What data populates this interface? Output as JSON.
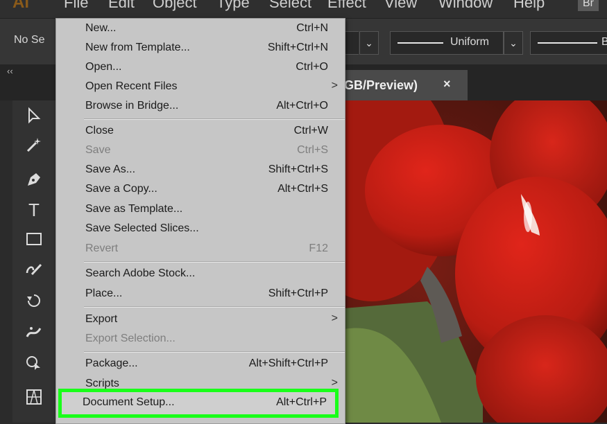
{
  "menubar": {
    "app_logo": "Ai",
    "items": [
      "File",
      "Edit",
      "Object",
      "Type",
      "Select",
      "Effect",
      "View",
      "Window",
      "Help"
    ],
    "right_badge": "Br"
  },
  "controlbar": {
    "selection_label": "No Se",
    "stroke_profile_label": "Uniform",
    "brush_partial_label": "B"
  },
  "tabbar": {
    "collapse_label": "‹‹",
    "document_tab_title": "GB/Preview)",
    "document_tab_close": "×"
  },
  "tools": [
    {
      "name": "selection-tool-icon"
    },
    {
      "name": "magic-wand-tool-icon"
    },
    {
      "name": "pen-tool-icon"
    },
    {
      "name": "type-tool-icon",
      "glyph": "T"
    },
    {
      "name": "rectangle-tool-icon"
    },
    {
      "name": "paintbrush-tool-icon"
    },
    {
      "name": "rotate-tool-icon"
    },
    {
      "name": "puppet-warp-tool-icon"
    },
    {
      "name": "shape-builder-tool-icon"
    },
    {
      "name": "perspective-grid-tool-icon"
    }
  ],
  "file_menu": {
    "items": [
      {
        "label": "New...",
        "shortcut": "Ctrl+N",
        "enabled": true
      },
      {
        "label": "New from Template...",
        "shortcut": "Shift+Ctrl+N",
        "enabled": true
      },
      {
        "label": "Open...",
        "shortcut": "Ctrl+O",
        "enabled": true
      },
      {
        "label": "Open Recent Files",
        "shortcut": "",
        "submenu": ">",
        "enabled": true
      },
      {
        "label": "Browse in Bridge...",
        "shortcut": "Alt+Ctrl+O",
        "enabled": true
      },
      {
        "label": "Close",
        "shortcut": "Ctrl+W",
        "enabled": true
      },
      {
        "label": "Save",
        "shortcut": "Ctrl+S",
        "enabled": false
      },
      {
        "label": "Save As...",
        "shortcut": "Shift+Ctrl+S",
        "enabled": true
      },
      {
        "label": "Save a Copy...",
        "shortcut": "Alt+Ctrl+S",
        "enabled": true
      },
      {
        "label": "Save as Template...",
        "shortcut": "",
        "enabled": true
      },
      {
        "label": "Save Selected Slices...",
        "shortcut": "",
        "enabled": true
      },
      {
        "label": "Revert",
        "shortcut": "F12",
        "enabled": false
      },
      {
        "label": "Search Adobe Stock...",
        "shortcut": "",
        "enabled": true
      },
      {
        "label": "Place...",
        "shortcut": "Shift+Ctrl+P",
        "enabled": true
      },
      {
        "label": "Export",
        "shortcut": "",
        "submenu": ">",
        "enabled": true
      },
      {
        "label": "Export Selection...",
        "shortcut": "",
        "enabled": false
      },
      {
        "label": "Package...",
        "shortcut": "Alt+Shift+Ctrl+P",
        "enabled": true
      },
      {
        "label": "Scripts",
        "shortcut": "",
        "submenu": ">",
        "enabled": true
      },
      {
        "label": "Document Setup...",
        "shortcut": "Alt+Ctrl+P",
        "enabled": true,
        "highlighted": true
      }
    ]
  },
  "colors": {
    "highlight_outline": "#19ff19",
    "menu_background": "#c6c6c6",
    "canvas_image_primary": "#b21d12"
  }
}
